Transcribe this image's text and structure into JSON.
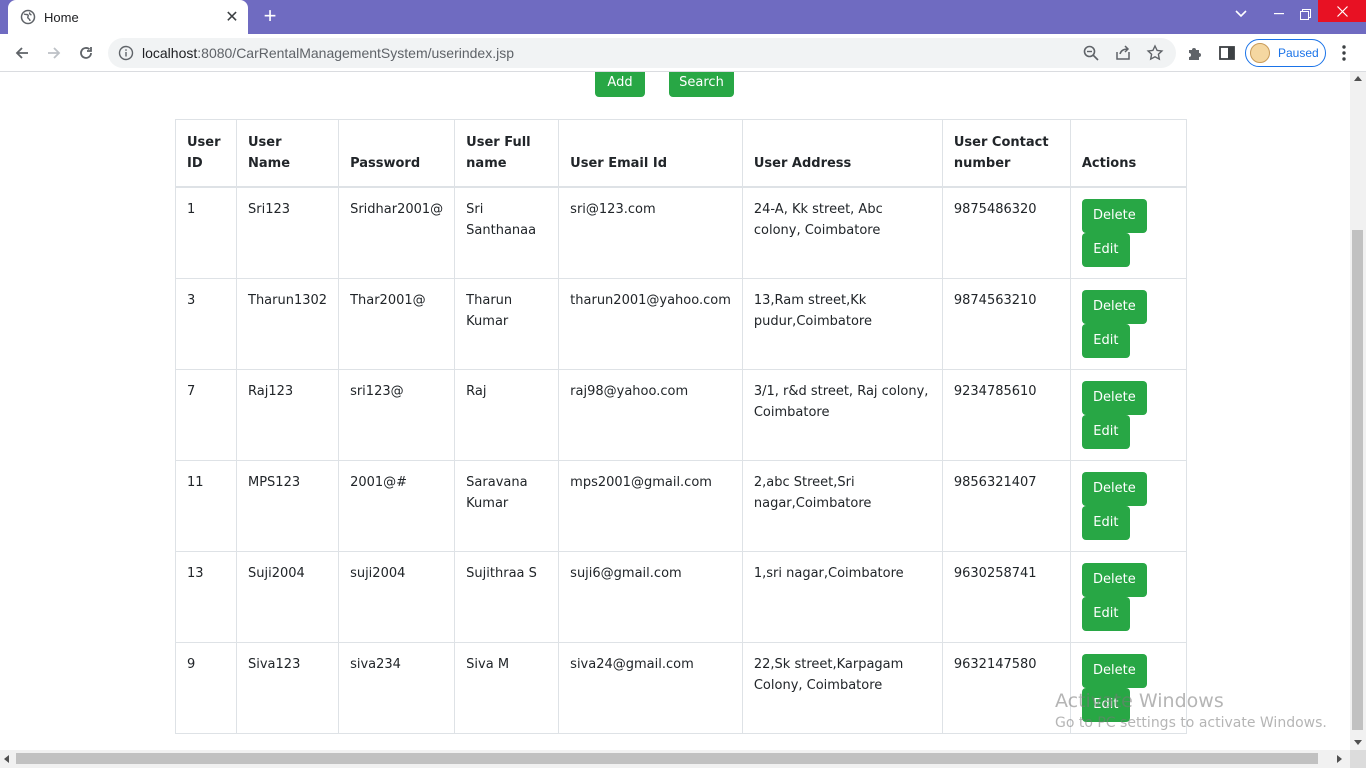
{
  "browser": {
    "tab_title": "Home",
    "url_host": "localhost",
    "url_path": ":8080/CarRentalManagementSystem/userindex.jsp",
    "profile_label": "Paused",
    "theme_color": "#6f6bc1"
  },
  "page": {
    "add_label": "Add",
    "search_label": "Search",
    "accent_color": "#28a745",
    "columns": [
      "User ID",
      "User Name",
      "Password",
      "User Full name",
      "User Email Id",
      "User Address",
      "User Contact number",
      "Actions"
    ],
    "delete_label": "Delete",
    "edit_label": "Edit",
    "rows": [
      {
        "id": "1",
        "username": "Sri123",
        "password": "Sridhar2001@",
        "fullname": "Sri Santhanaa",
        "email": "sri@123.com",
        "address": "24-A, Kk street, Abc colony, Coimbatore",
        "contact": "9875486320"
      },
      {
        "id": "3",
        "username": "Tharun1302",
        "password": "Thar2001@",
        "fullname": "Tharun Kumar",
        "email": "tharun2001@yahoo.com",
        "address": "13,Ram street,Kk pudur,Coimbatore",
        "contact": "9874563210"
      },
      {
        "id": "7",
        "username": "Raj123",
        "password": "sri123@",
        "fullname": "Raj",
        "email": "raj98@yahoo.com",
        "address": "3/1, r&d street, Raj colony, Coimbatore",
        "contact": "9234785610"
      },
      {
        "id": "11",
        "username": "MPS123",
        "password": "2001@#",
        "fullname": "Saravana Kumar",
        "email": "mps2001@gmail.com",
        "address": "2,abc Street,Sri nagar,Coimbatore",
        "contact": "9856321407"
      },
      {
        "id": "13",
        "username": "Suji2004",
        "password": "suji2004",
        "fullname": "Sujithraa S",
        "email": "suji6@gmail.com",
        "address": "1,sri nagar,Coimbatore",
        "contact": "9630258741"
      },
      {
        "id": "9",
        "username": "Siva123",
        "password": "siva234",
        "fullname": "Siva M",
        "email": "siva24@gmail.com",
        "address": "22,Sk street,Karpagam Colony, Coimbatore",
        "contact": "9632147580"
      }
    ]
  },
  "watermark": {
    "title": "Activate Windows",
    "subtitle": "Go to PC settings to activate Windows."
  }
}
